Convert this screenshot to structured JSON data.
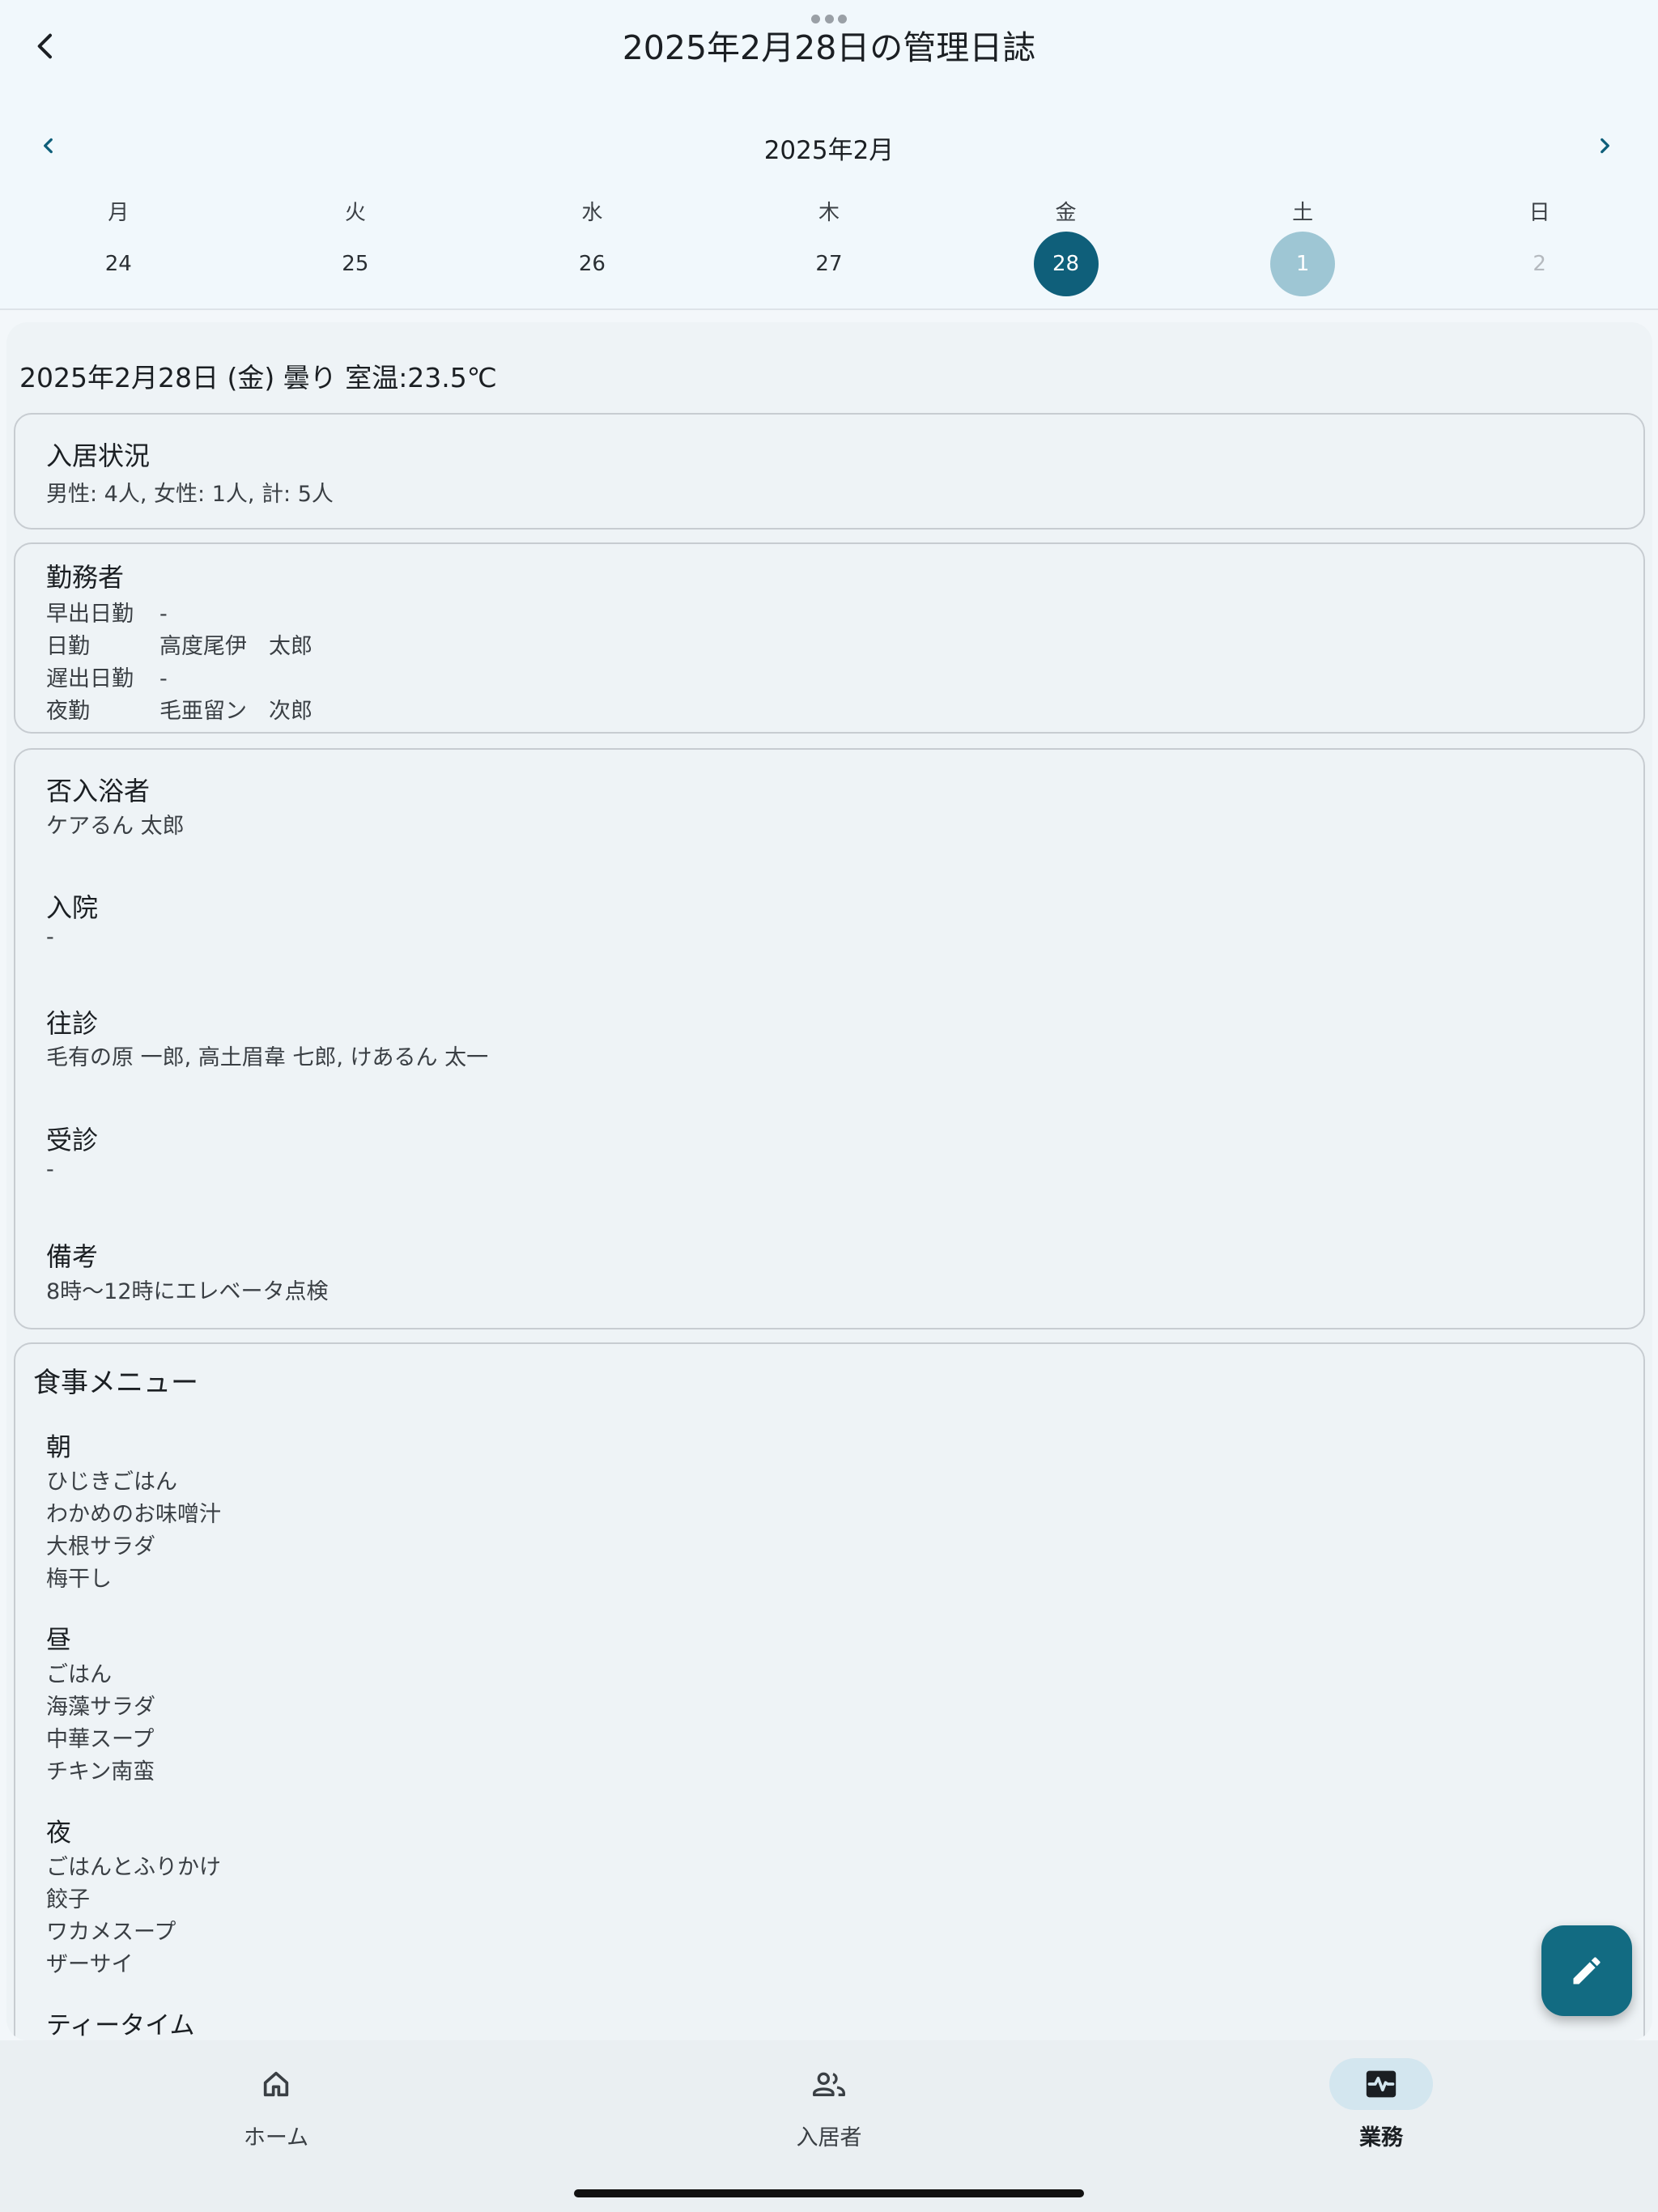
{
  "header": {
    "title": "2025年2月28日の管理日誌",
    "back_icon": "chevron-left-icon"
  },
  "calendar": {
    "month_label": "2025年2月",
    "weekdays": [
      "月",
      "火",
      "水",
      "木",
      "金",
      "土",
      "日"
    ],
    "dates": [
      "24",
      "25",
      "26",
      "27",
      "28",
      "1",
      "2"
    ],
    "selected_date": "28",
    "colors": {
      "selected": "#0f5f7a",
      "today_light": "#9ec6d4"
    }
  },
  "log": {
    "summary": "2025年2月28日 (金) 曇り 室温:23.5℃",
    "occupancy": {
      "title": "入居状況",
      "text": "男性: 4人, 女性: 1人, 計: 5人"
    },
    "staff": {
      "title": "勤務者",
      "rows": [
        {
          "role": "早出日勤",
          "name": "-"
        },
        {
          "role": "日勤",
          "name": "高度尾伊　太郎"
        },
        {
          "role": "遅出日勤",
          "name": "-"
        },
        {
          "role": "夜勤",
          "name": "毛亜留ン　次郎"
        }
      ]
    },
    "sections": [
      {
        "title": "否入浴者",
        "text": "ケアるん 太郎"
      },
      {
        "title": "入院",
        "text": "-"
      },
      {
        "title": "往診",
        "text": "毛有の原 一郎, 高土眉韋 七郎, けあるん 太一"
      },
      {
        "title": "受診",
        "text": "-"
      },
      {
        "title": "備考",
        "text": "8時〜12時にエレベータ点検"
      }
    ],
    "meals": {
      "title": "食事メニュー",
      "breakfast": {
        "title": "朝",
        "items": [
          "ひじきごはん",
          "わかめのお味噌汁",
          "大根サラダ",
          "梅干し"
        ]
      },
      "lunch": {
        "title": "昼",
        "items": [
          "ごはん",
          "海藻サラダ",
          "中華スープ",
          "チキン南蛮"
        ]
      },
      "dinner": {
        "title": "夜",
        "items": [
          "ごはんとふりかけ",
          "餃子",
          "ワカメスープ",
          "ザーサイ"
        ]
      },
      "tea": {
        "title": "ティータイム"
      }
    }
  },
  "fab": {
    "icon": "pencil-icon"
  },
  "bottom_nav": {
    "items": [
      {
        "label": "ホーム",
        "icon": "home-icon"
      },
      {
        "label": "入居者",
        "icon": "people-icon"
      },
      {
        "label": "業務",
        "icon": "activity-icon",
        "active": true
      }
    ],
    "active_color": "#d3e6ef"
  }
}
